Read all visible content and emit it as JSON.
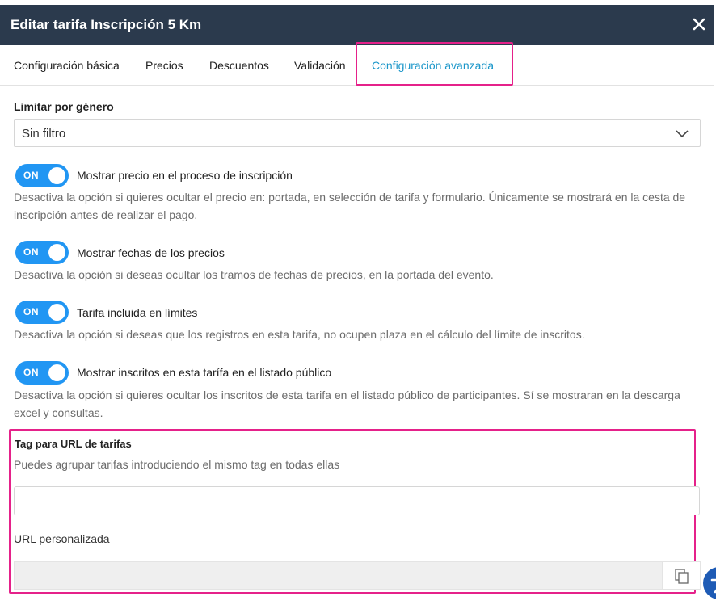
{
  "modal": {
    "title": "Editar tarifa Inscripción 5 Km"
  },
  "tabs": [
    {
      "label": "Configuración básica",
      "active": false
    },
    {
      "label": "Precios",
      "active": false
    },
    {
      "label": "Descuentos",
      "active": false
    },
    {
      "label": "Validación",
      "active": false
    },
    {
      "label": "Configuración avanzada",
      "active": true
    }
  ],
  "gender": {
    "label": "Limitar por género",
    "selected": "Sin filtro"
  },
  "toggles": [
    {
      "state": "ON",
      "label": "Mostrar precio en el proceso de inscripción",
      "description": "Desactiva la opción si quieres ocultar el precio en: portada, en selección de tarifa y formulario. Únicamente se mostrará en la cesta de inscripción antes de realizar el pago."
    },
    {
      "state": "ON",
      "label": "Mostrar fechas de los precios",
      "description": "Desactiva la opción si deseas ocultar los tramos de fechas de precios, en la portada del evento."
    },
    {
      "state": "ON",
      "label": "Tarifa incluida en límites",
      "description": "Desactiva la opción si deseas que los registros en esta tarifa, no ocupen plaza en el cálculo del límite de inscritos."
    },
    {
      "state": "ON",
      "label": "Mostrar inscritos en esta tarífa en el listado público",
      "description": "Desactiva la opción si quieres ocultar los inscritos de esta tarifa en el listado público de participantes. Sí se mostraran en la descarga excel y consultas."
    }
  ],
  "tag_section": {
    "title": "Tag para URL de tarifas",
    "description": "Puedes agrupar tarifas introduciendo el mismo tag en todas ellas",
    "tag_value": "",
    "url_label": "URL personalizada",
    "url_value": ""
  },
  "icons": {
    "close": "close-icon",
    "dropdown": "chevron-down-icon",
    "copy": "copy-icon",
    "accessibility": "accessibility-icon"
  },
  "colors": {
    "header_bg": "#2b3a4d",
    "active_tab": "#1a96c9",
    "toggle_on": "#2196f3",
    "highlight": "#e5218a"
  }
}
